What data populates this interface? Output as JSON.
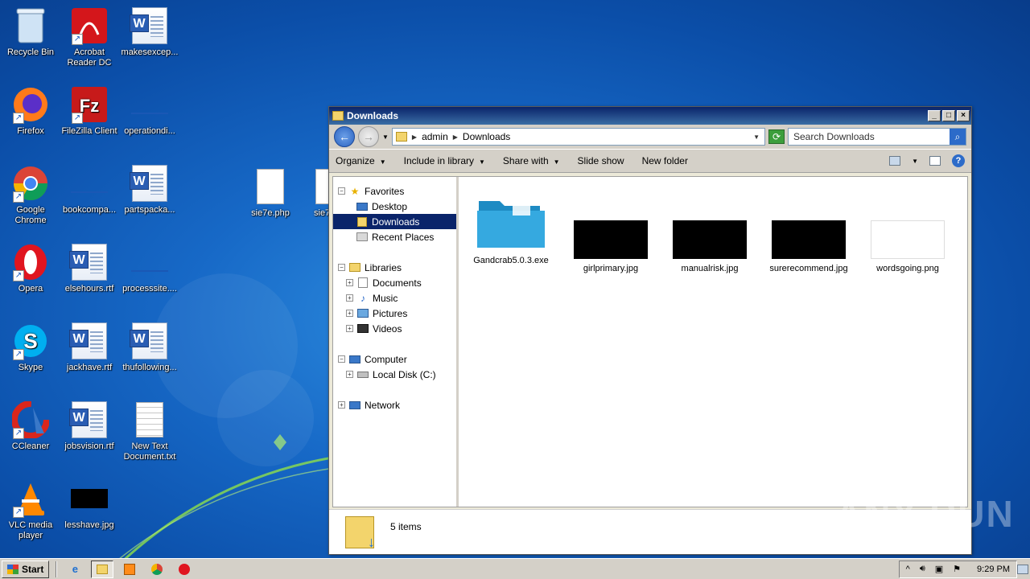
{
  "desktop": {
    "icons": [
      {
        "label": "Recycle Bin"
      },
      {
        "label": "Acrobat Reader DC"
      },
      {
        "label": "makesexcep..."
      },
      {
        "label": "Firefox"
      },
      {
        "label": "FileZilla Client"
      },
      {
        "label": "operationdi..."
      },
      {
        "label": "Google Chrome"
      },
      {
        "label": "bookcompa..."
      },
      {
        "label": "partspacka..."
      },
      {
        "label": "sie7e.php"
      },
      {
        "label": "sie7"
      },
      {
        "label": "Opera"
      },
      {
        "label": "elsehours.rtf"
      },
      {
        "label": "processsite...."
      },
      {
        "label": "Skype"
      },
      {
        "label": "jackhave.rtf"
      },
      {
        "label": "thufollowing..."
      },
      {
        "label": "CCleaner"
      },
      {
        "label": "jobsvision.rtf"
      },
      {
        "label": "New Text Document.txt"
      },
      {
        "label": "VLC media player"
      },
      {
        "label": "lesshave.jpg"
      }
    ]
  },
  "window": {
    "title": "Downloads",
    "address": {
      "crumbs": [
        "admin",
        "Downloads"
      ]
    },
    "search_placeholder": "Search Downloads",
    "toolbar": {
      "organize": "Organize",
      "include_in_library": "Include in library",
      "share_with": "Share with",
      "slide_show": "Slide show",
      "new_folder": "New folder"
    },
    "nav": {
      "favorites": "Favorites",
      "desktop": "Desktop",
      "downloads": "Downloads",
      "recent_places": "Recent Places",
      "libraries": "Libraries",
      "documents": "Documents",
      "music": "Music",
      "pictures": "Pictures",
      "videos": "Videos",
      "computer": "Computer",
      "local_disk": "Local Disk (C:)",
      "network": "Network"
    },
    "files": [
      {
        "name": "Gandcrab5.0.3.exe"
      },
      {
        "name": "girlprimary.jpg"
      },
      {
        "name": "manualrisk.jpg"
      },
      {
        "name": "surerecommend.jpg"
      },
      {
        "name": "wordsgoing.png"
      }
    ],
    "status": "5 items"
  },
  "taskbar": {
    "start_label": "Start",
    "clock": "9:29 PM"
  },
  "watermark": "ANY RUN"
}
